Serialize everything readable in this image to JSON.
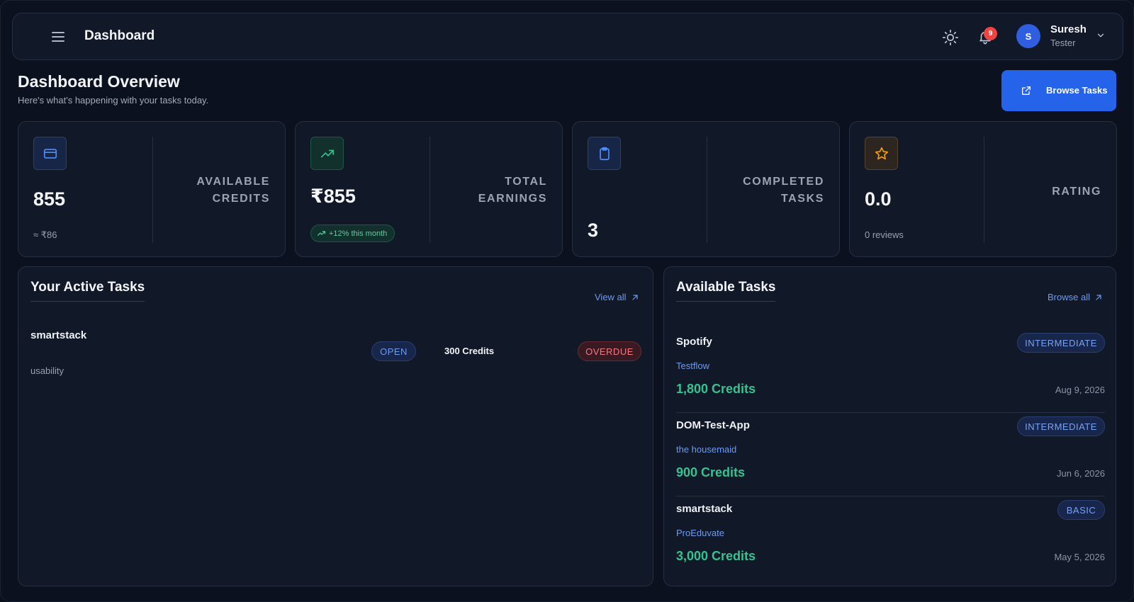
{
  "topbar": {
    "title": "Dashboard",
    "notifications_count": "9",
    "user": {
      "initial": "S",
      "name": "Suresh",
      "role": "Tester"
    }
  },
  "header": {
    "title": "Dashboard Overview",
    "subtitle": "Here's what's happening with your tasks today.",
    "browse_button": "Browse Tasks"
  },
  "stats": [
    {
      "icon": "credit-card-icon",
      "value": "855",
      "label": "AVAILABLE CREDITS",
      "sub": "≈ ₹86",
      "accent": "#3b82f6"
    },
    {
      "icon": "trending-up-icon",
      "value": "₹855",
      "label": "TOTAL EARNINGS",
      "badge": "+12% this month",
      "accent": "#34c391"
    },
    {
      "icon": "clipboard-icon",
      "value": "3",
      "label": "COMPLETED TASKS",
      "accent": "#3b82f6"
    },
    {
      "icon": "star-icon",
      "value": "0.0",
      "label": "RATING",
      "sub": "0 reviews",
      "accent": "#f59e0b"
    }
  ],
  "active_tasks": {
    "title": "Your Active Tasks",
    "link": "View all",
    "items": [
      {
        "name": "smartstack",
        "category": "usability",
        "status": "OPEN",
        "credits": "300 Credits",
        "due": "OVERDUE"
      }
    ]
  },
  "available_tasks": {
    "title": "Available Tasks",
    "link": "Browse all",
    "items": [
      {
        "name": "Spotify",
        "company": "Testflow",
        "level": "INTERMEDIATE",
        "credits": "1,800 Credits",
        "date": "Aug 9, 2026"
      },
      {
        "name": "DOM-Test-App",
        "company": "the housemaid",
        "level": "INTERMEDIATE",
        "credits": "900 Credits",
        "date": "Jun 6, 2026"
      },
      {
        "name": "smartstack",
        "company": "ProEduvate",
        "level": "BASIC",
        "credits": "3,000 Credits",
        "date": "May 5, 2026"
      }
    ]
  },
  "colors": {
    "background": "#0b111e",
    "card": "#111827",
    "primary": "#2563eb",
    "success": "#34c391",
    "danger": "#ef4444"
  }
}
